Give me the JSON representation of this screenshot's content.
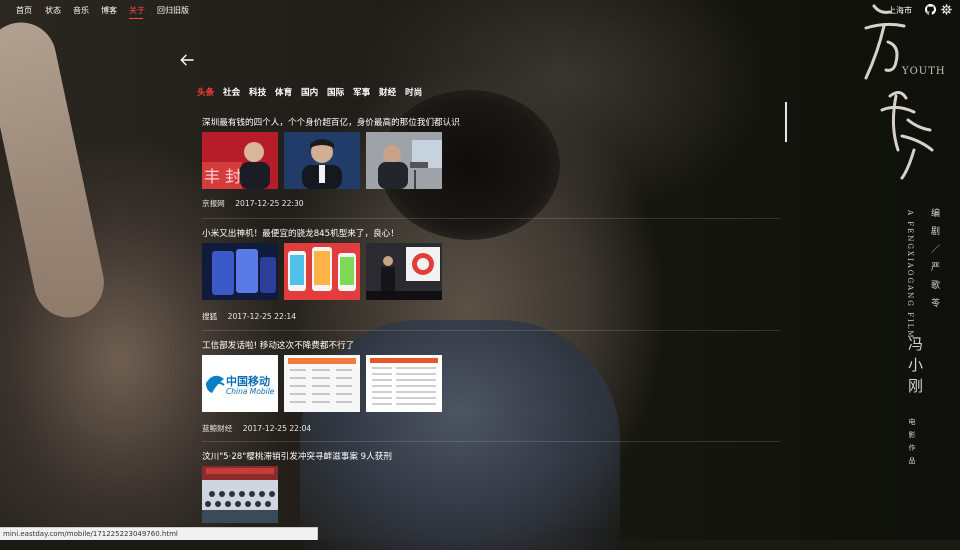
{
  "topnav": {
    "items": [
      "首页",
      "状态",
      "音乐",
      "博客",
      "关于",
      "回归旧版"
    ],
    "active_index": 4,
    "city": "上海市"
  },
  "icons": {
    "back": "arrow-left-icon",
    "github": "github-icon",
    "settings": "gear-icon"
  },
  "tabs": [
    "头条",
    "社会",
    "科技",
    "体育",
    "国内",
    "国际",
    "军事",
    "财经",
    "时尚"
  ],
  "active_tab": 0,
  "news": [
    {
      "title": "深圳最有钱的四个人，个个身价超百亿，身价最高的那位我们都认识",
      "source": "京报网",
      "time": "2017-12-25 22:30"
    },
    {
      "title": "小米又出神机！最便宜的骁龙845机型来了，良心！",
      "source": "搜狐",
      "time": "2017-12-25 22:14"
    },
    {
      "title": "工信部发话啦! 移动这次不降费都不行了",
      "source": "蓝鲸财经",
      "time": "2017-12-25 22:04"
    },
    {
      "title": "汶川\"5·28\"樱桃滞销引发冲突寻衅滋事案 9人获刑",
      "source": "",
      "time": ""
    }
  ],
  "thumb_text": {
    "china_mobile_cn": "中国移动",
    "china_mobile_en": "China Mobile"
  },
  "poster": {
    "youth": "YOUTH",
    "credit_en": "A FENGXIAOGANG FILM",
    "credit_cn1": "编剧／严歌苓",
    "credit_cn2": "冯小刚",
    "credit_cn3": "电影作品"
  },
  "status_url": "mini.eastday.com/mobile/171225223049760.html",
  "colors": {
    "accent": "#ff3b3b",
    "text": "#ffffff"
  }
}
